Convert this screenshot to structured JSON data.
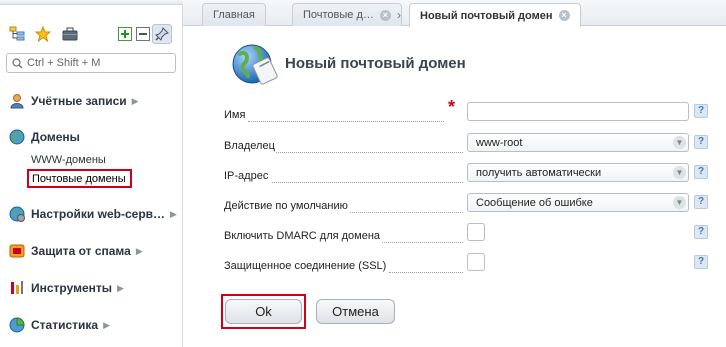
{
  "sidebar": {
    "search_placeholder": "Ctrl + Shift + M",
    "groups": [
      {
        "label": "Учётные записи"
      },
      {
        "label": "Домены"
      },
      {
        "label": "Настройки web-серв…"
      },
      {
        "label": "Защита от спама"
      },
      {
        "label": "Инструменты"
      },
      {
        "label": "Статистика"
      }
    ],
    "domain_items": [
      {
        "label": "WWW-домены"
      },
      {
        "label": "Почтовые домены",
        "selected": true
      }
    ]
  },
  "tabs": [
    {
      "label": "Главная"
    },
    {
      "label": "Почтовые д…"
    },
    {
      "label": "Новый почтовый домен",
      "active": true
    }
  ],
  "page": {
    "title": "Новый почтовый домен"
  },
  "form": {
    "fields": [
      {
        "label": "Имя",
        "type": "text",
        "value": "",
        "required": true
      },
      {
        "label": "Владелец",
        "type": "select",
        "value": "www-root"
      },
      {
        "label": "IP-адрес",
        "type": "select",
        "value": "получить автоматически"
      },
      {
        "label": "Действие по умолчанию",
        "type": "select",
        "value": "Сообщение об ошибке"
      },
      {
        "label": "Включить DMARC для домена",
        "type": "checkbox",
        "value": false
      },
      {
        "label": "Защищенное соединение (SSL)",
        "type": "checkbox",
        "value": false
      }
    ],
    "ok_label": "Ok",
    "cancel_label": "Отмена",
    "help_glyph": "?"
  },
  "colors": {
    "accent_red": "#d0001a",
    "help_blue": "#4a78a8"
  }
}
